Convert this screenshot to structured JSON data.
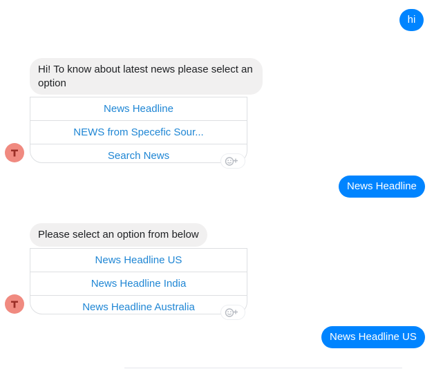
{
  "messages": {
    "user_1": "hi",
    "bot_1": "Hi! To know about latest news please select an option",
    "bot_1_options": [
      "News Headline",
      "NEWS from Specefic Sour...",
      "Search News"
    ],
    "user_2": "News Headline",
    "bot_2": "Please select an option from below",
    "bot_2_options": [
      "News Headline US",
      "News Headline India",
      "News Headline Australia"
    ],
    "user_3": "News Headline US"
  },
  "avatar": {
    "initial": "T",
    "color": "#f08a80",
    "letter_color": "#9b2f27"
  },
  "colors": {
    "outgoing": "#0084ff",
    "incoming": "#f1f0f0",
    "link": "#1f86d4"
  },
  "icons": {
    "reaction": "smiley-plus-icon"
  }
}
